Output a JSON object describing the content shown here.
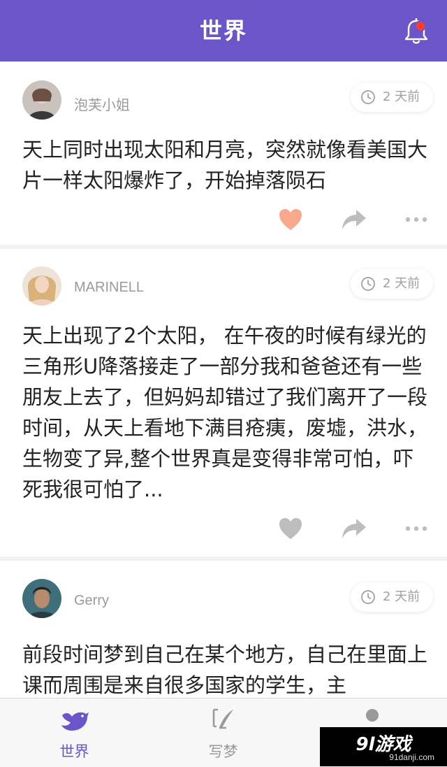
{
  "header": {
    "title": "世界",
    "notification_icon": "bell-icon",
    "has_notification_dot": true
  },
  "posts": [
    {
      "username": "泡芙小姐",
      "time": "2 天前",
      "text": "天上同时出现太阳和月亮，突然就像看美国大片一样太阳爆炸了，开始掉落陨石",
      "liked": true
    },
    {
      "username": "MARINELL",
      "time": "2 天前",
      "text": "天上出现了2个太阳， 在午夜的时候有绿光的三角形U降落接走了一部分我和爸爸还有一些朋友上去了，但妈妈却错过了我们离开了一段时间，从天上看地下满目疮痍，废墟，洪水，生物变了异,整个世界真是变得非常可怕，吓死我很可怕了...",
      "liked": false
    },
    {
      "username": "Gerry",
      "time": "2 天前",
      "text": "前段时间梦到自己在某个地方，自己在里面上课而周围是来自很多国家的学生，主",
      "liked": false
    }
  ],
  "tabs": [
    {
      "label": "世界",
      "icon": "bird-icon",
      "active": true
    },
    {
      "label": "写梦",
      "icon": "write-icon",
      "active": false
    },
    {
      "label": "",
      "icon": "person-icon",
      "active": false
    }
  ],
  "watermark": {
    "logo": "9l游戏",
    "url": "91danji.com"
  },
  "colors": {
    "accent": "#6a56c8",
    "like": "#f8a98b",
    "icon_gray": "#bdbdbd",
    "dot": "#ff3b30"
  }
}
